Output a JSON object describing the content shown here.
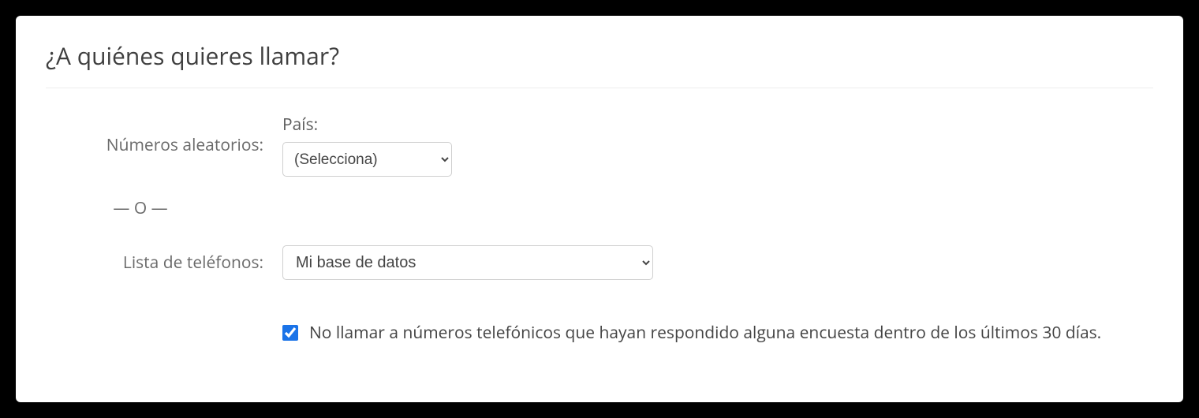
{
  "title": "¿A quiénes quieres llamar?",
  "randomRow": {
    "label": "Números aleatorios:",
    "countryLabel": "País:",
    "countrySelected": "(Selecciona)"
  },
  "separator": "— O —",
  "listRow": {
    "label": "Lista de teléfonos:",
    "selected": "Mi base de datos"
  },
  "exclude": {
    "checked": true,
    "label": "No llamar a números telefónicos que hayan respondido alguna encuesta dentro de los últimos 30 días."
  }
}
